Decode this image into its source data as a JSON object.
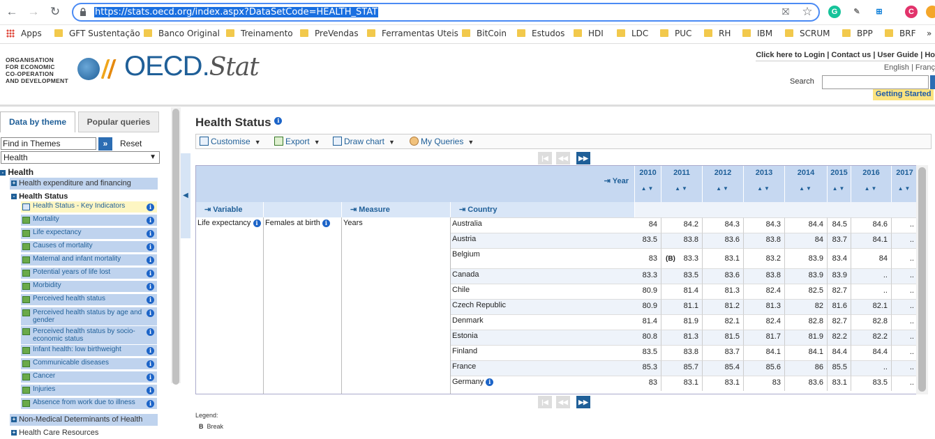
{
  "browser": {
    "url": "https://stats.oecd.org/index.aspx?DataSetCode=HEALTH_STAT",
    "profile_initial": "C"
  },
  "bookmarks": [
    "Apps",
    "GFT Sustentação",
    "Banco Original",
    "Treinamento",
    "PreVendas",
    "Ferramentas Uteis",
    "BitCoin",
    "Estudos",
    "HDI",
    "LDC",
    "PUC",
    "RH",
    "IBM",
    "SCRUM",
    "BPP",
    "BRF"
  ],
  "header": {
    "org_lines": [
      "ORGANISATION",
      "FOR ECONOMIC",
      "CO-OPERATION",
      "AND DEVELOPMENT"
    ],
    "logo_main": "OECD.",
    "logo_sub": "Stat",
    "top_links": "Click here to Login | Contact us | User Guide | Ho",
    "languages": "English | Franç",
    "search_label": "Search",
    "getting_started": "Getting Started"
  },
  "sidebar": {
    "tab_active": "Data by theme",
    "tab_inactive": "Popular queries",
    "find_placeholder": "Find in Themes",
    "find_go": "»",
    "reset": "Reset",
    "theme": "Health",
    "tree_root": "Health",
    "node_expenditure": "Health expenditure and financing",
    "node_status": "Health Status",
    "leaves": [
      "Health Status - Key Indicators",
      "Mortality",
      "Life expectancy",
      "Causes of mortality",
      "Maternal and infant mortality",
      "Potential years of life lost",
      "Morbidity",
      "Perceived health status",
      "Perceived health status by age and gender",
      "Perceived health status by socio-economic status",
      "Infant health: low birthweight",
      "Communicable diseases",
      "Cancer",
      "Injuries",
      "Absence from work due to illness"
    ],
    "node_nonmedical": "Non-Medical Determinants of Health",
    "node_resources": "Health Care Resources"
  },
  "main": {
    "title": "Health Status",
    "toolbar": [
      "Customise",
      "Export",
      "Draw chart",
      "My Queries"
    ],
    "year_label": "Year",
    "years": [
      "2010",
      "2011",
      "2012",
      "2013",
      "2014",
      "2015",
      "2016",
      "2017"
    ],
    "variable_label": "Variable",
    "measure_label": "Measure",
    "country_label": "Country",
    "variable": "Life expectancy",
    "sub_variable": "Females at birth",
    "measure": "Years",
    "break_flag": "(B)",
    "rows": [
      {
        "country": "Australia",
        "values": [
          "84",
          "84.2",
          "84.3",
          "84.3",
          "84.4",
          "84.5",
          "84.6",
          ".."
        ]
      },
      {
        "country": "Austria",
        "values": [
          "83.5",
          "83.8",
          "83.6",
          "83.8",
          "84",
          "83.7",
          "84.1",
          ".."
        ]
      },
      {
        "country": "Belgium",
        "values": [
          "83",
          "83.3",
          "83.1",
          "83.2",
          "83.9",
          "83.4",
          "84",
          ".."
        ]
      },
      {
        "country": "Canada",
        "values": [
          "83.3",
          "83.5",
          "83.6",
          "83.8",
          "83.9",
          "83.9",
          "..",
          ".."
        ]
      },
      {
        "country": "Chile",
        "values": [
          "80.9",
          "81.4",
          "81.3",
          "82.4",
          "82.5",
          "82.7",
          "..",
          ".."
        ]
      },
      {
        "country": "Czech Republic",
        "values": [
          "80.9",
          "81.1",
          "81.2",
          "81.3",
          "82",
          "81.6",
          "82.1",
          ".."
        ]
      },
      {
        "country": "Denmark",
        "values": [
          "81.4",
          "81.9",
          "82.1",
          "82.4",
          "82.8",
          "82.7",
          "82.8",
          ".."
        ]
      },
      {
        "country": "Estonia",
        "values": [
          "80.8",
          "81.3",
          "81.5",
          "81.7",
          "81.9",
          "82.2",
          "82.2",
          ".."
        ]
      },
      {
        "country": "Finland",
        "values": [
          "83.5",
          "83.8",
          "83.7",
          "84.1",
          "84.1",
          "84.4",
          "84.4",
          ".."
        ]
      },
      {
        "country": "France",
        "values": [
          "85.3",
          "85.7",
          "85.4",
          "85.6",
          "86",
          "85.5",
          "..",
          ".."
        ]
      },
      {
        "country": "Germany",
        "values": [
          "83",
          "83.1",
          "83.1",
          "83",
          "83.6",
          "83.1",
          "83.5",
          ".."
        ]
      }
    ],
    "legend_title": "Legend:",
    "legend_b": "B",
    "legend_b_text": "Break"
  }
}
